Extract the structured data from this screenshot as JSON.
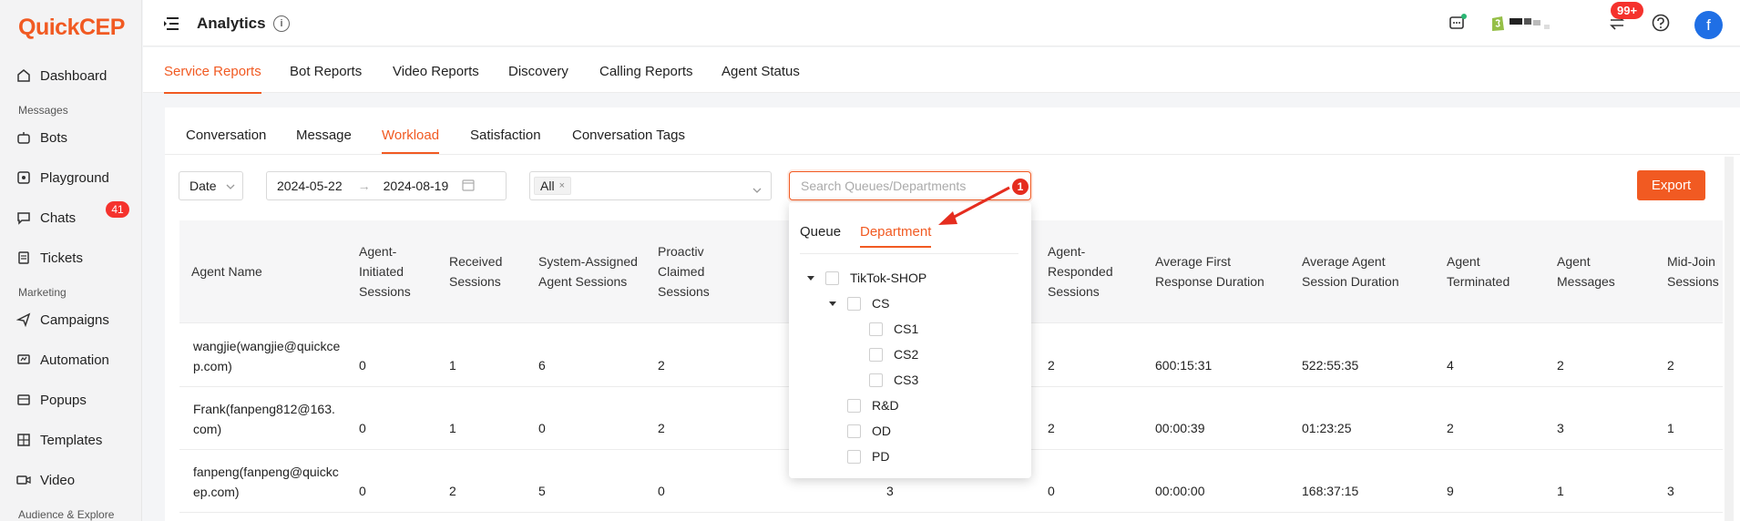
{
  "brand": {
    "name": "QuickCEP"
  },
  "sidebar": {
    "items": [
      {
        "label": "Dashboard",
        "icon": "home-icon"
      },
      {
        "label": "Bots",
        "icon": "bot-icon"
      },
      {
        "label": "Playground",
        "icon": "playground-icon"
      },
      {
        "label": "Chats",
        "icon": "chat-icon",
        "badge": "41"
      },
      {
        "label": "Tickets",
        "icon": "ticket-icon"
      },
      {
        "label": "Campaigns",
        "icon": "send-icon"
      },
      {
        "label": "Automation",
        "icon": "automation-icon"
      },
      {
        "label": "Popups",
        "icon": "popup-icon"
      },
      {
        "label": "Templates",
        "icon": "template-icon"
      },
      {
        "label": "Video",
        "icon": "video-icon"
      }
    ],
    "groups": [
      "Messages",
      "Marketing",
      "Audience & Explore"
    ]
  },
  "header": {
    "title": "Analytics",
    "notifications": "99+",
    "avatar_letter": "f"
  },
  "report_tabs": [
    "Service Reports",
    "Bot Reports",
    "Video Reports",
    "Discovery",
    "Calling Reports",
    "Agent Status"
  ],
  "sub_tabs": [
    "Conversation",
    "Message",
    "Workload",
    "Satisfaction",
    "Conversation Tags"
  ],
  "filters": {
    "date_type": "Date",
    "start_date": "2024-05-22",
    "arrow": "→",
    "end_date": "2024-08-19",
    "agent_tag": "All",
    "search_placeholder": "Search Queues/Departments",
    "export_label": "Export"
  },
  "table": {
    "headers": [
      "Agent Name",
      "Agent-\nInitiated\nSessions",
      "Received\nSessions",
      "System-Assigned\nAgent Sessions",
      "Proactiv\nClaimed\nSessions",
      "Agent-\nResponded\nSessions",
      "Average First\nResponse Duration",
      "Average Agent\nSession Duration",
      "Agent\nTerminated",
      "Agent\nMessages",
      "Mid-Join\nSessions"
    ],
    "rows": [
      {
        "name": "wangjie(wangjie@quickce\np.com)",
        "initiated": "0",
        "received": "1",
        "assigned": "6",
        "claimed": "2",
        "responded": "2",
        "first_resp": "600:15:31",
        "session_dur": "522:55:35",
        "terminated": "4",
        "messages": "2",
        "midjoin": "2"
      },
      {
        "name": "Frank(fanpeng812@163.\ncom)",
        "initiated": "0",
        "received": "1",
        "assigned": "0",
        "claimed": "2",
        "responded": "2",
        "first_resp": "00:00:39",
        "session_dur": "01:23:25",
        "terminated": "2",
        "messages": "3",
        "midjoin": "1"
      },
      {
        "name": "fanpeng(fanpeng@quickc\nep.com)",
        "initiated": "0",
        "received": "2",
        "assigned": "5",
        "claimed": "0",
        "hidden": "3",
        "responded": "0",
        "first_resp": "00:00:00",
        "session_dur": "168:37:15",
        "terminated": "9",
        "messages": "1",
        "midjoin": "3"
      }
    ]
  },
  "dropdown": {
    "tabs": [
      "Queue",
      "Department"
    ],
    "tree": [
      {
        "label": "TikTok-SHOP",
        "level": 0,
        "expanded": true
      },
      {
        "label": "CS",
        "level": 1,
        "expanded": true
      },
      {
        "label": "CS1",
        "level": 2
      },
      {
        "label": "CS2",
        "level": 2
      },
      {
        "label": "CS3",
        "level": 2
      },
      {
        "label": "R&D",
        "level": 1
      },
      {
        "label": "OD",
        "level": 1
      },
      {
        "label": "PD",
        "level": 1
      }
    ]
  },
  "annotation": {
    "number": "1",
    "color": "#e52d1f"
  },
  "colors": {
    "accent": "#f15a22",
    "badge": "#f5322d",
    "avatar": "#1f6fe5"
  }
}
